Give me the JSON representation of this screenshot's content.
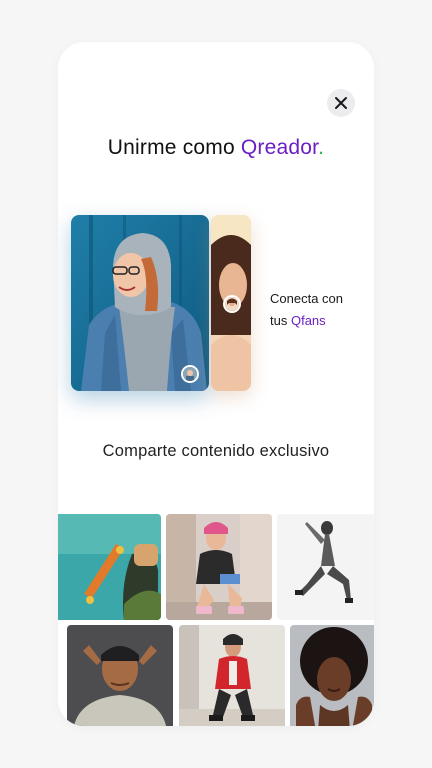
{
  "title": {
    "prefix": "Unirme como ",
    "brand": "Qreador",
    "dot": "."
  },
  "close": {
    "icon": "close-icon"
  },
  "connect": {
    "line1": "Conecta con",
    "line2_prefix": "tus ",
    "line2_brand": "Qfans"
  },
  "subtitle": "Comparte contenido exclusivo",
  "colors": {
    "accent": "#6a1fc4",
    "dot": "#27b45a",
    "background": "#f6f6f7",
    "card": "#ffffff"
  },
  "gallery": {
    "row1": [
      "skateboard-photo",
      "rollerskater-photo",
      "dancer-photo"
    ],
    "row2": [
      "man-cap-photo",
      "woman-red-jacket-photo",
      "woman-portrait-photo"
    ]
  }
}
